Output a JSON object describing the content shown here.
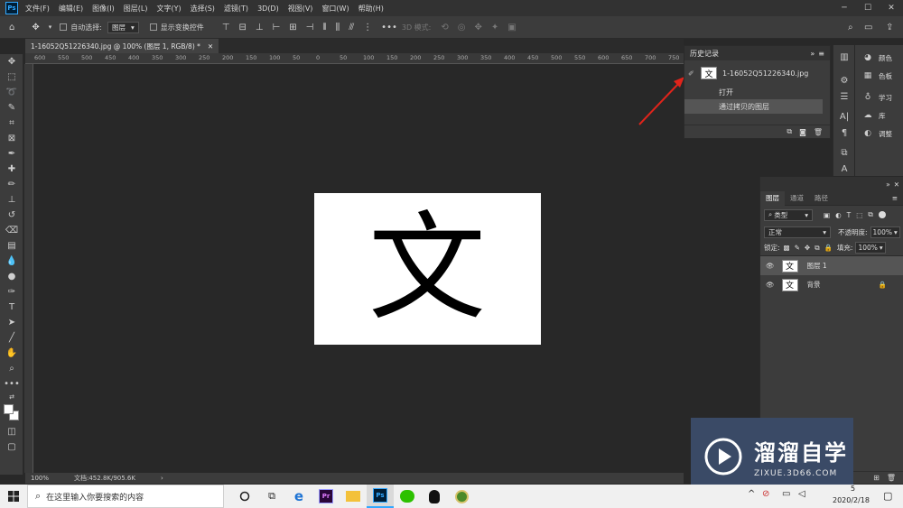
{
  "menubar": {
    "logo": "Ps",
    "items": [
      "文件(F)",
      "编辑(E)",
      "图像(I)",
      "图层(L)",
      "文字(Y)",
      "选择(S)",
      "滤镜(T)",
      "3D(D)",
      "视图(V)",
      "窗口(W)",
      "帮助(H)"
    ]
  },
  "options": {
    "auto_select_label": "自动选择:",
    "auto_select_value": "图层",
    "show_transform_label": "显示变换控件",
    "mode_3d_label": "3D 模式:"
  },
  "document": {
    "tab_title": "1-16052Q51226340.jpg @ 100% (图层 1, RGB/8) *",
    "glyph": "文"
  },
  "ruler": {
    "h_ticks": [
      "600",
      "550",
      "500",
      "450",
      "400",
      "350",
      "300",
      "250",
      "200",
      "150",
      "100",
      "50",
      "0",
      "50",
      "100",
      "150",
      "200",
      "250",
      "300",
      "350",
      "400",
      "450",
      "500",
      "550",
      "600",
      "650",
      "700",
      "750"
    ]
  },
  "status": {
    "zoom": "100%",
    "doc_info": "文档:452.8K/905.6K"
  },
  "history": {
    "title": "历史记录",
    "snapshot_label": "1-16052Q51226340.jpg",
    "snapshot_glyph": "文",
    "steps": [
      "打开",
      "通过拷贝的图层"
    ]
  },
  "right_panels": {
    "items": [
      "颜色",
      "色板",
      "学习",
      "库",
      "调整"
    ]
  },
  "layers_panel": {
    "tabs": [
      "图层",
      "通道",
      "路径"
    ],
    "filter_label": "类型",
    "blend_mode": "正常",
    "opacity_label": "不透明度:",
    "opacity_value": "100%",
    "lock_label": "锁定:",
    "fill_label": "填充:",
    "fill_value": "100%",
    "layers": [
      {
        "name": "图层 1",
        "glyph": "文"
      },
      {
        "name": "背景",
        "glyph": "文"
      }
    ]
  },
  "watermark": {
    "title": "溜溜自学",
    "url": "ZIXUE.3D66.COM"
  },
  "taskbar": {
    "search_placeholder": "在这里输入你要搜索的内容",
    "date": "2020/2/18",
    "time_fragment": "5"
  },
  "colors": {
    "accent_blue": "#31a8ff",
    "arrow_red": "#e0241b",
    "watermark_bg": "#3a4a66"
  }
}
